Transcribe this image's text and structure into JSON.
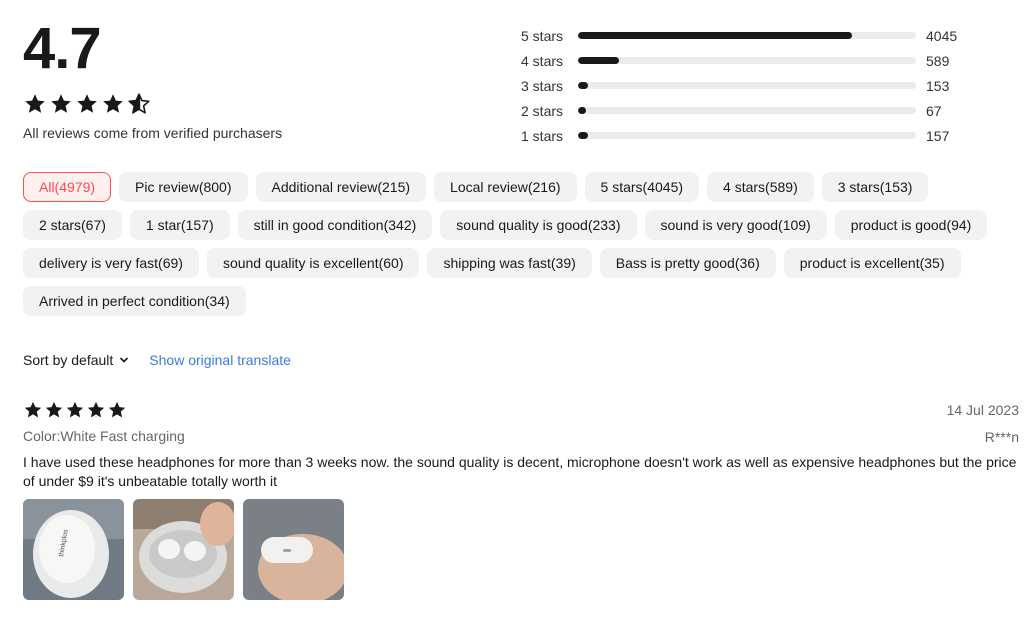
{
  "summary": {
    "rating": "4.7",
    "rating_value": 4.7,
    "verified_text": "All reviews come from verified purchasers"
  },
  "histogram": [
    {
      "label": "5 stars",
      "count": "4045",
      "fraction": 0.81
    },
    {
      "label": "4 stars",
      "count": "589",
      "fraction": 0.12
    },
    {
      "label": "3 stars",
      "count": "153",
      "fraction": 0.03
    },
    {
      "label": "2 stars",
      "count": "67",
      "fraction": 0.013
    },
    {
      "label": "1 stars",
      "count": "157",
      "fraction": 0.03
    }
  ],
  "filters": [
    "All(4979)",
    "Pic review(800)",
    "Additional review(215)",
    "Local review(216)",
    "5 stars(4045)",
    "4 stars(589)",
    "3 stars(153)",
    "2 stars(67)",
    "1 star(157)",
    "still in good condition(342)",
    "sound quality is good(233)",
    "sound is very good(109)",
    "product is good(94)",
    "delivery is very fast(69)",
    "sound quality is excellent(60)",
    "shipping was fast(39)",
    "Bass is pretty good(36)",
    "product is excellent(35)",
    "Arrived in perfect condition(34)"
  ],
  "active_filter": 0,
  "sort": {
    "label": "Sort by default",
    "translate_link": "Show original translate"
  },
  "review": {
    "stars": 5,
    "date": "14 Jul 2023",
    "user": "R***n",
    "variant": "Color:White Fast charging",
    "text": "I have used these headphones for more than 3 weeks now. the sound quality is decent, microphone doesn't work as well as expensive headphones but the price of under $9 it's unbeatable totally worth it",
    "photos": [
      "earbuds-case-photo",
      "open-case-photo",
      "hand-holding-case-photo"
    ],
    "photo_case_text": "thinkplus"
  },
  "colors": {
    "accent": "#ff4a50",
    "link": "#3b7ae0",
    "bar": "#191919",
    "track": "#ebebeb",
    "chip": "#f2f2f2"
  }
}
